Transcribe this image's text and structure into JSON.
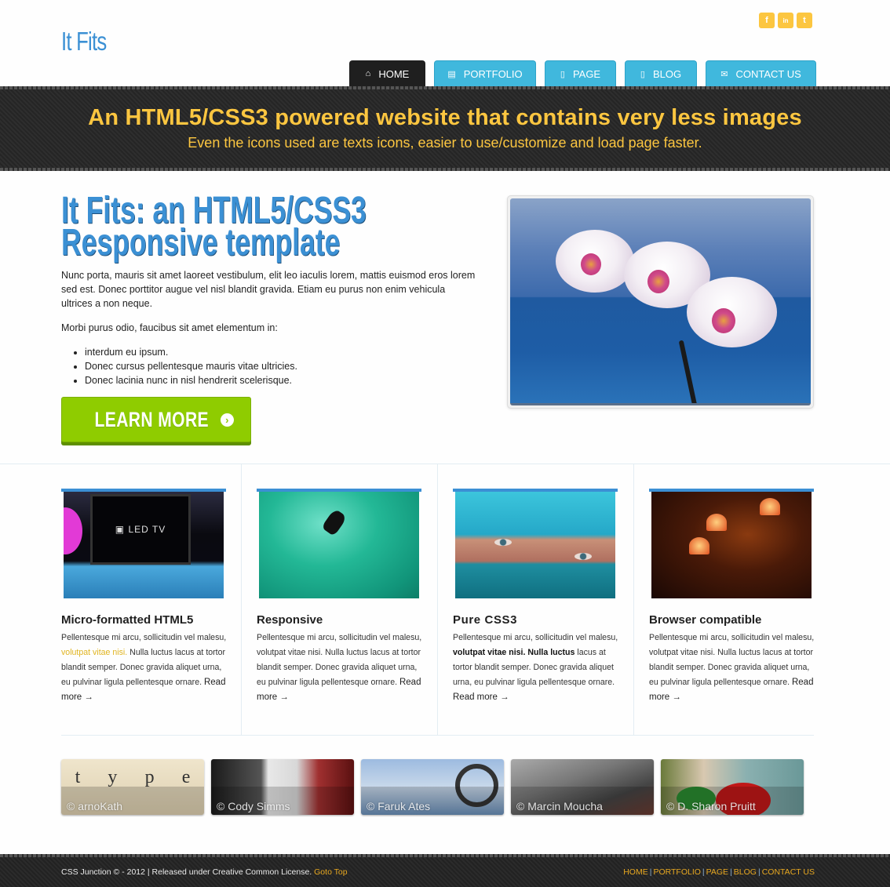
{
  "header": {
    "logo": "It Fits",
    "social": [
      {
        "icon": "facebook-icon",
        "glyph": "f"
      },
      {
        "icon": "linkedin-icon",
        "glyph": "in"
      },
      {
        "icon": "twitter-icon",
        "glyph": "t"
      }
    ],
    "nav": [
      {
        "label": "HOME",
        "icon": "home-icon",
        "glyph": "⌂",
        "active": true
      },
      {
        "label": "PORTFOLIO",
        "icon": "notebook-icon",
        "glyph": "▤",
        "active": false
      },
      {
        "label": "PAGE",
        "icon": "page-icon",
        "glyph": "▯",
        "active": false
      },
      {
        "label": "BLOG",
        "icon": "page-icon",
        "glyph": "▯",
        "active": false
      },
      {
        "label": "CONTACT US",
        "icon": "envelope-icon",
        "glyph": "✉",
        "active": false
      }
    ]
  },
  "banner": {
    "headline": "An HTML5/CSS3 powered website that contains very less images",
    "subline": "Even the icons used are texts icons, easier to use/customize and load page faster."
  },
  "hero": {
    "title_line1": "It Fits: an HTML5/CSS3",
    "title_line2": "Responsive template",
    "paragraph1": "Nunc porta, mauris sit amet laoreet vestibulum, elit leo iaculis lorem, mattis euismod eros lorem sed est. Donec porttitor augue vel nisl blandit gravida. Etiam eu purus non enim vehicula ultrices a non neque.",
    "paragraph2": "Morbi purus odio, faucibus sit amet elementum in:",
    "bullets": [
      "interdum eu ipsum.",
      "Donec cursus pellentesque mauris vitae ultricies.",
      "Donec lacinia nunc in nisl hendrerit scelerisque."
    ],
    "button_label": "LEARN MORE",
    "button_icon": "chevron-right-circle-icon",
    "image_alt": "orchid over blue sea"
  },
  "features": [
    {
      "title": "Micro-formatted HTML5",
      "text_before": "Pellentesque mi arcu, sollicitudin vel malesu, ",
      "highlight": "volutpat vitae nisi.",
      "text_after": " Nulla luctus lacus at tortor blandit semper. Donec gravida aliquet urna, eu pulvinar ligula pellentesque ornare. ",
      "read_more": "Read more →",
      "image": "led tv display"
    },
    {
      "title": "Responsive",
      "text": "Pellentesque mi arcu, sollicitudin vel malesu, volutpat vitae nisi. Nulla luctus lacus at tortor blandit semper. Donec gravida aliquet urna, eu pulvinar ligula pellentesque ornare. ",
      "read_more": "Read more →",
      "image": "surfer on green wave"
    },
    {
      "title": "Pure CSS3",
      "text_before": "Pellentesque mi arcu, sollicitudin vel malesu, ",
      "bold": "volutpat vitae nisi. Nulla luctus",
      "text_after": " lacus at tortor blandit semper. Donec gravida aliquet urna, eu pulvinar ligula pellentesque ornare. ",
      "read_more": "Read more →",
      "image": "face with turquoise scarf"
    },
    {
      "title": "Browser compatible",
      "text": "Pellentesque mi arcu, sollicitudin vel malesu, volutpat vitae nisi. Nulla luctus lacus at tortor blandit semper. Donec gravida aliquet urna, eu pulvinar ligula pellentesque ornare. ",
      "read_more": "Read more →",
      "image": "bar with lamps"
    }
  ],
  "gallery": [
    {
      "caption": "© arnoKath",
      "letters": [
        "t",
        "y",
        "p",
        "e"
      ]
    },
    {
      "caption": "© Cody Simms"
    },
    {
      "caption": "© Faruk Ates"
    },
    {
      "caption": "© Marcin Moucha"
    },
    {
      "caption": "© D. Sharon Pruitt"
    }
  ],
  "footer": {
    "copyright": "CSS Junction © - 2012 | Released under Creative Common License. ",
    "goto_top": "Goto Top",
    "links": [
      "HOME",
      "PORTFOLIO",
      "PAGE",
      "BLOG",
      "CONTACT US"
    ],
    "separator": "|"
  },
  "colors": {
    "brand_blue": "#3b90d4",
    "nav_blue": "#40b8dd",
    "accent_yellow": "#fcc640",
    "button_green": "#8fcc00",
    "footer_link": "#e8a820"
  }
}
